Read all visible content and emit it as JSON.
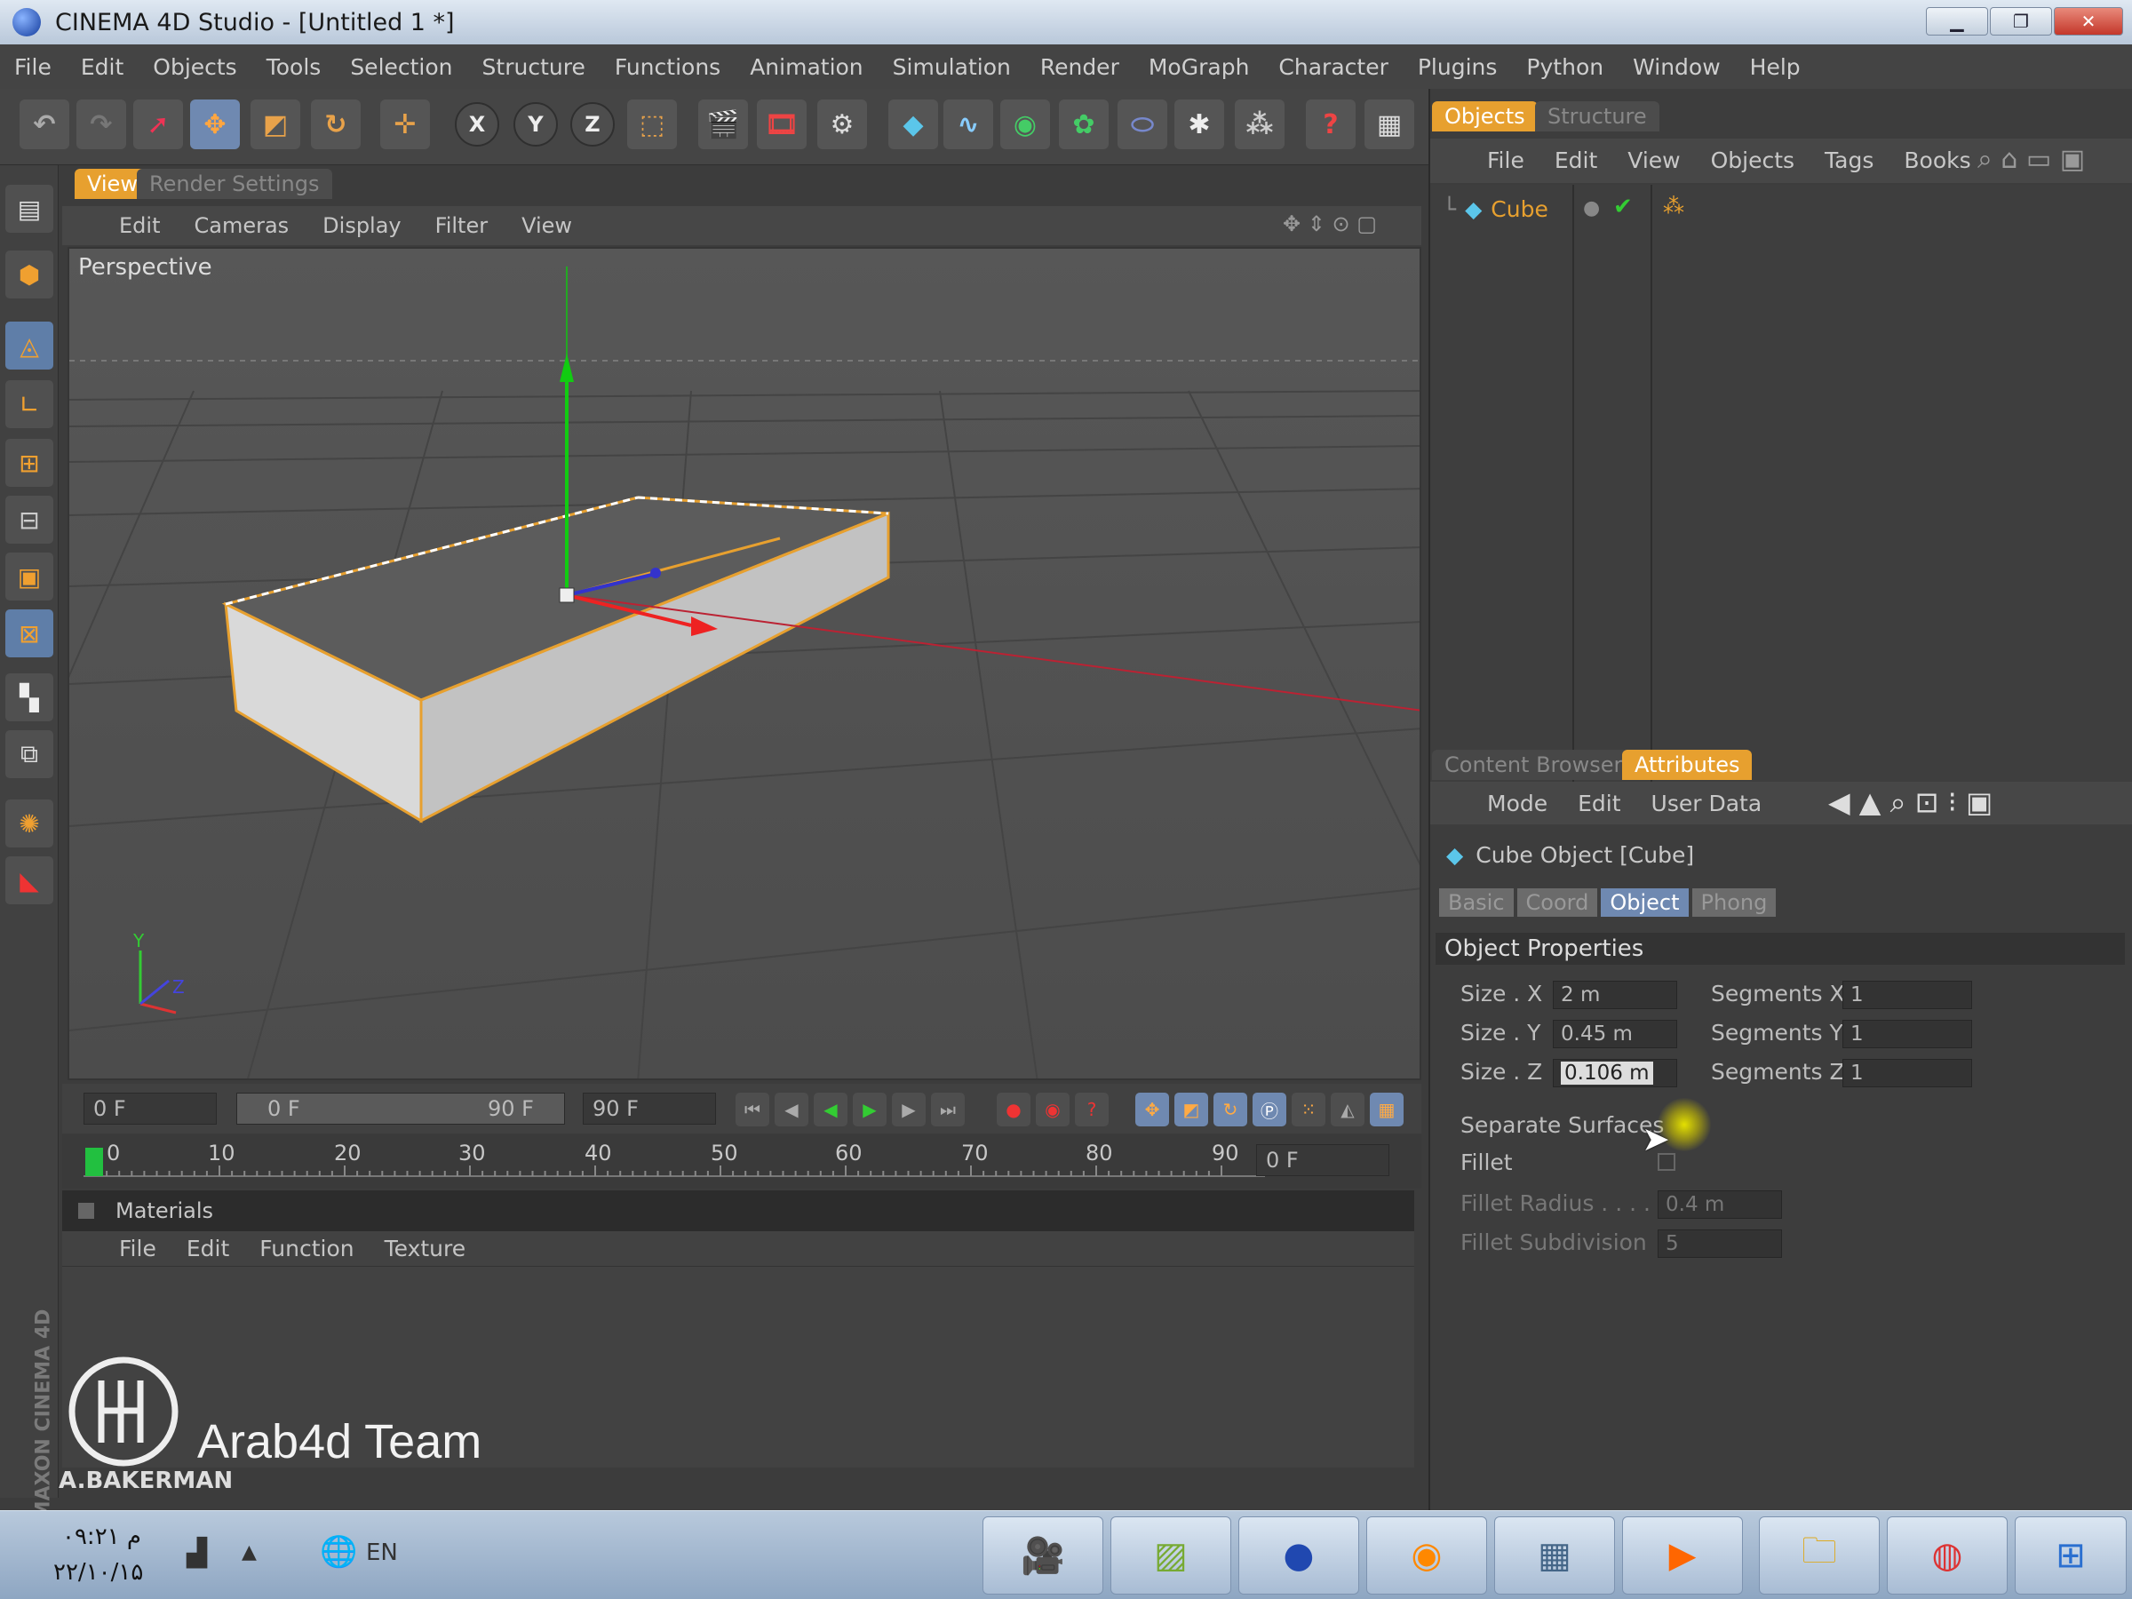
{
  "window": {
    "title": "CINEMA 4D Studio - [Untitled 1 *]"
  },
  "menubar": [
    "File",
    "Edit",
    "Objects",
    "Tools",
    "Selection",
    "Structure",
    "Functions",
    "Animation",
    "Simulation",
    "Render",
    "MoGraph",
    "Character",
    "Plugins",
    "Python",
    "Window",
    "Help"
  ],
  "view_tabs": {
    "view": "View",
    "render_settings": "Render Settings"
  },
  "viewport_menu": [
    "Edit",
    "Cameras",
    "Display",
    "Filter",
    "View"
  ],
  "viewport": {
    "label": "Perspective"
  },
  "timeline": {
    "start": "0 F",
    "slider_left": "0 F",
    "slider_right": "90 F",
    "end": "90 F",
    "current": "0 F",
    "ticks": [
      "0",
      "10",
      "20",
      "30",
      "40",
      "50",
      "60",
      "70",
      "80",
      "90"
    ]
  },
  "materials": {
    "title": "Materials",
    "menu": [
      "File",
      "Edit",
      "Function",
      "Texture"
    ]
  },
  "watermark": {
    "brand": "Arab4d Team",
    "author": "A.BAKERMAN",
    "vertical": "MAXON CINEMA 4D"
  },
  "objects_panel": {
    "tabs": {
      "objects": "Objects",
      "structure": "Structure"
    },
    "menu": [
      "File",
      "Edit",
      "View",
      "Objects",
      "Tags",
      "Books"
    ],
    "items": [
      {
        "name": "Cube"
      }
    ]
  },
  "attributes_panel": {
    "tabs": {
      "content_browser": "Content Browser",
      "attributes": "Attributes"
    },
    "menu": [
      "Mode",
      "Edit",
      "User Data"
    ],
    "object_title": "Cube Object [Cube]",
    "subtabs": {
      "basic": "Basic",
      "coord": "Coord",
      "object": "Object",
      "phong": "Phong"
    },
    "section": "Object Properties",
    "size_x_label": "Size . X",
    "size_x": "2 m",
    "size_y_label": "Size . Y",
    "size_y": "0.45 m",
    "size_z_label": "Size . Z",
    "size_z": "0.106 m",
    "seg_x_label": "Segments X",
    "seg_x": "1",
    "seg_y_label": "Segments Y",
    "seg_y": "1",
    "seg_z_label": "Segments Z",
    "seg_z": "1",
    "separate_surfaces": "Separate Surfaces",
    "fillet": "Fillet",
    "fillet_radius_label": "Fillet Radius . . . . .",
    "fillet_radius": "0.4 m",
    "fillet_subdivision_label": "Fillet Subdivision",
    "fillet_subdivision": "5"
  },
  "taskbar": {
    "time": "م ۰۹:۲۱",
    "date": "۲۲/۱۰/۱۵",
    "lang": "EN"
  },
  "colors": {
    "accent": "#e7a02f",
    "selection": "#5f7ea8",
    "bg": "#3c3c3c"
  }
}
